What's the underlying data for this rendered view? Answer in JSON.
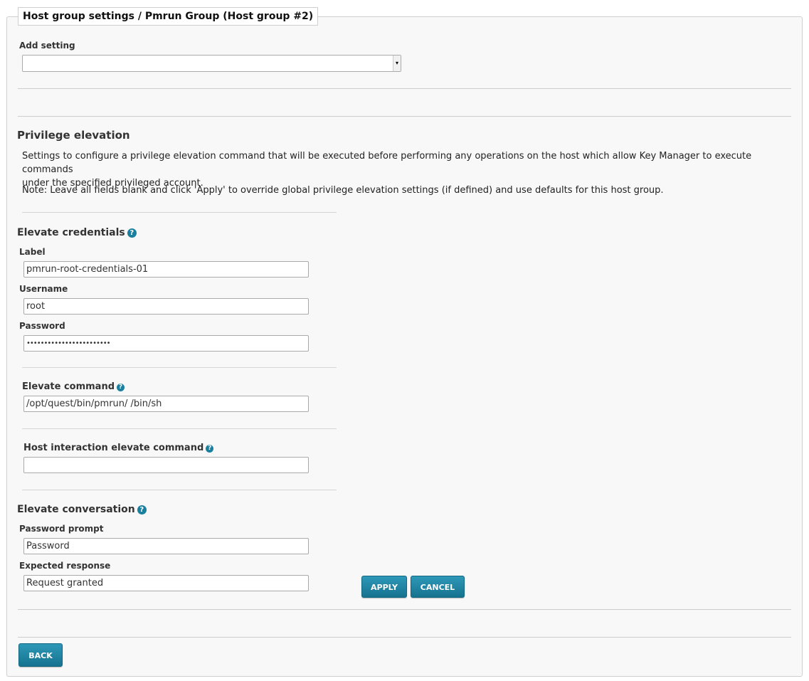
{
  "panel": {
    "title": "Host group settings / Pmrun Group (Host group #2)"
  },
  "add_setting": {
    "label": "Add setting",
    "selected": ""
  },
  "privilege": {
    "heading": "Privilege elevation",
    "description_1": "Settings to configure a privilege elevation command that will be executed before performing any operations on the host which allow Key Manager to execute commands",
    "description_2": "under the specified privileged account.",
    "note": "Note: Leave all fields blank and click 'Apply' to override global privilege elevation settings (if defined) and use defaults for this host group."
  },
  "credentials": {
    "heading": "Elevate credentials",
    "label_label": "Label",
    "label_value": "pmrun-root-credentials-01",
    "username_label": "Username",
    "username_value": "root",
    "password_label": "Password",
    "password_value": "••••••••••••••••••••••••"
  },
  "elevate_command": {
    "label": "Elevate command",
    "value": "/opt/quest/bin/pmrun/ /bin/sh"
  },
  "host_interaction": {
    "label": "Host interaction elevate command",
    "value": ""
  },
  "conversation": {
    "heading": "Elevate conversation",
    "prompt_label": "Password prompt",
    "prompt_value": "Password",
    "response_label": "Expected response",
    "response_value": "Request granted"
  },
  "buttons": {
    "apply": "APPLY",
    "cancel": "CANCEL",
    "back": "BACK"
  },
  "icons": {
    "help": "?",
    "select_arrow": "▾"
  },
  "colors": {
    "accent": "#1b7f9e",
    "button": "#16738f"
  }
}
